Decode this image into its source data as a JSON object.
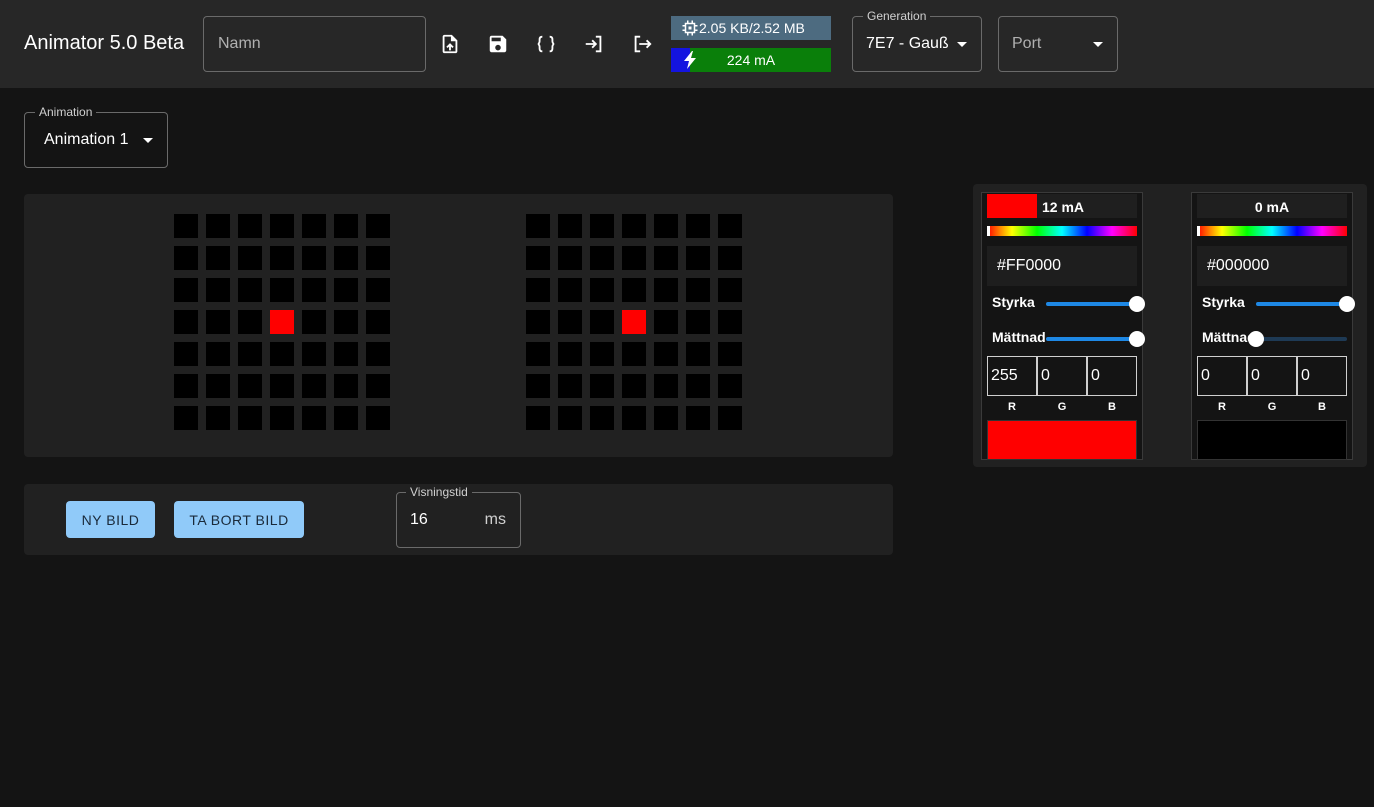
{
  "header": {
    "title": "Animator 5.0 Beta",
    "name_placeholder": "Namn",
    "memory": "2.05 KB/2.52 MB",
    "current": "224 mA",
    "current_fraction": 0.12,
    "generation_label": "Generation",
    "generation_value": "7E7 - Gauß",
    "port_value": "Port",
    "icons": [
      "upload-file-icon",
      "save-icon",
      "code-braces-icon",
      "login-icon",
      "logout-icon"
    ]
  },
  "animation": {
    "label": "Animation",
    "value": "Animation 1"
  },
  "matrices": [
    {
      "rows": 7,
      "cols": 7,
      "lit": [
        {
          "row": 3,
          "col": 3,
          "color": "#ff0000"
        }
      ]
    },
    {
      "rows": 7,
      "cols": 7,
      "lit": [
        {
          "row": 3,
          "col": 3,
          "color": "#ff0000"
        }
      ]
    }
  ],
  "controls": {
    "new_frame": "NY BILD",
    "delete_frame": "TA BORT BILD",
    "display_time_label": "Visningstid",
    "display_time_value": "16",
    "display_time_unit": "ms"
  },
  "colors": [
    {
      "current": "12 mA",
      "hex": "#FF0000",
      "swatch": "#ff0000",
      "strength_label": "Styrka",
      "strength": 1.0,
      "saturation_label": "Mättnad",
      "saturation": 1.0,
      "r": "255",
      "g": "0",
      "b": "0",
      "r_label": "R",
      "g_label": "G",
      "b_label": "B"
    },
    {
      "current": "0 mA",
      "hex": "#000000",
      "swatch": "#000000",
      "strength_label": "Styrka",
      "strength": 1.0,
      "saturation_label": "Mättnad",
      "saturation": 0.0,
      "r": "0",
      "g": "0",
      "b": "0",
      "r_label": "R",
      "g_label": "G",
      "b_label": "B"
    }
  ],
  "accent": "#1e88e5"
}
